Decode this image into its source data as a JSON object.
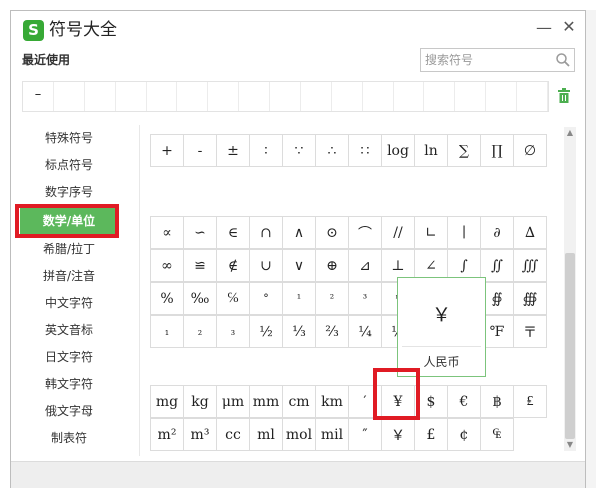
{
  "title": "符号大全",
  "logo_letter": "S",
  "recent_label": "最近使用",
  "recent_symbols": [
    "–",
    "",
    "",
    "",
    "",
    "",
    "",
    "",
    "",
    "",
    "",
    "",
    "",
    "",
    "",
    "",
    ""
  ],
  "search": {
    "placeholder": "搜索符号"
  },
  "window_controls": {
    "minimize": "—",
    "close": "✕"
  },
  "categories": [
    {
      "label": "特殊符号",
      "active": false
    },
    {
      "label": "标点符号",
      "active": false
    },
    {
      "label": "数字序号",
      "active": false
    },
    {
      "label": "数学/单位",
      "active": true
    },
    {
      "label": "希腊/拉丁",
      "active": false
    },
    {
      "label": "拼音/注音",
      "active": false
    },
    {
      "label": "中文字符",
      "active": false
    },
    {
      "label": "英文音标",
      "active": false
    },
    {
      "label": "日文字符",
      "active": false
    },
    {
      "label": "韩文字符",
      "active": false
    },
    {
      "label": "俄文字母",
      "active": false
    },
    {
      "label": "制表符",
      "active": false
    }
  ],
  "symbol_rows": [
    [
      "+",
      "-",
      "±",
      "∶",
      "∵",
      "∴",
      "∷",
      "log",
      "ln",
      "∑",
      "∏",
      "∅"
    ],
    [
      "∝",
      "∽",
      "∈",
      "∩",
      "∧",
      "⊙",
      "⌒",
      "//",
      "∟",
      "∣",
      "∂",
      "∆"
    ],
    [
      "∞",
      "≌",
      "∉",
      "∪",
      "∨",
      "⊕",
      "⊿",
      "⊥",
      "∠",
      "∫",
      "∬",
      "∭"
    ],
    [
      "%",
      "‰",
      "℅",
      "°",
      "¹",
      "²",
      "³",
      "ⁿ",
      "",
      "",
      "∯",
      "∰"
    ],
    [
      "₁",
      "₂",
      "₃",
      "½",
      "⅓",
      "⅔",
      "¼",
      "½",
      "",
      "",
      "℉",
      "〒"
    ],
    [
      "mg",
      "kg",
      "μm",
      "mm",
      "cm",
      "km",
      "′",
      "¥",
      "$",
      "€",
      "฿",
      "₤"
    ],
    [
      "m²",
      "m³",
      "cc",
      "ml",
      "mol",
      "mil",
      "″",
      "￥",
      "£",
      "¢",
      "₠"
    ]
  ],
  "popup": {
    "symbol": "￥",
    "name": "人民币"
  }
}
